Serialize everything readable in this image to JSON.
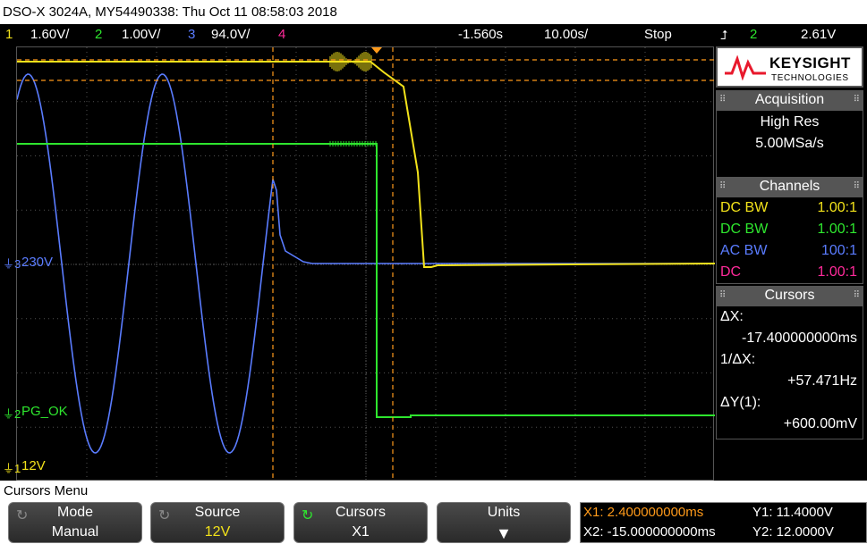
{
  "title_bar": "DSO-X 3024A, MY54490338: Thu Oct 11 08:58:03 2018",
  "status": {
    "ch1_num": "1",
    "ch1_scale": "1.60V/",
    "ch2_num": "2",
    "ch2_scale": "1.00V/",
    "ch3_num": "3",
    "ch3_scale": "94.0V/",
    "ch4_num": "4",
    "time_offset": "-1.560s",
    "time_scale": "10.00s/",
    "run_state": "Stop",
    "trigger_source": "2",
    "trigger_level": "2.61V"
  },
  "waveform_labels": {
    "ch3_label": "230V",
    "ch2_label": "PG_OK",
    "ch1_label": "12V",
    "ch3_ground": "3",
    "ch2_ground": "2",
    "ch1_ground": "1"
  },
  "side_panel": {
    "brand": "KEYSIGHT",
    "brand_sub": "TECHNOLOGIES",
    "acquisition": {
      "header": "Acquisition",
      "mode": "High Res",
      "rate": "5.00MSa/s"
    },
    "channels": {
      "header": "Channels",
      "rows": [
        {
          "coupling": "DC BW",
          "probe": "1.00:1",
          "color": "#f2e21a"
        },
        {
          "coupling": "DC BW",
          "probe": "1.00:1",
          "color": "#2ee62e"
        },
        {
          "coupling": "AC BW",
          "probe": "100:1",
          "color": "#5a7cff"
        },
        {
          "coupling": "DC",
          "probe": "1.00:1",
          "color": "#ff2a9a"
        }
      ]
    },
    "cursors": {
      "header": "Cursors",
      "dx_label": "ΔX:",
      "dx_value": "-17.400000000ms",
      "inv_dx_label": "1/ΔX:",
      "inv_dx_value": "+57.471Hz",
      "dy_label": "ΔY(1):",
      "dy_value": "+600.00mV"
    }
  },
  "menu": {
    "title": "Cursors Menu",
    "softkeys": [
      {
        "label": "Mode",
        "value": "Manual"
      },
      {
        "label": "Source",
        "value": "12V"
      },
      {
        "label": "Cursors",
        "value": "X1"
      },
      {
        "label": "Units",
        "value": ""
      }
    ]
  },
  "readout": {
    "x1": "X1: 2.400000000ms",
    "x2": "X2: -15.000000000ms",
    "y1": "Y1: 11.4000V",
    "y2": "Y2: 12.0000V"
  },
  "colors": {
    "ch1": "#f2e21a",
    "ch2": "#2ee62e",
    "ch3": "#5a7cff",
    "ch4": "#ff2a9a",
    "cursor": "#ff9a1a"
  }
}
